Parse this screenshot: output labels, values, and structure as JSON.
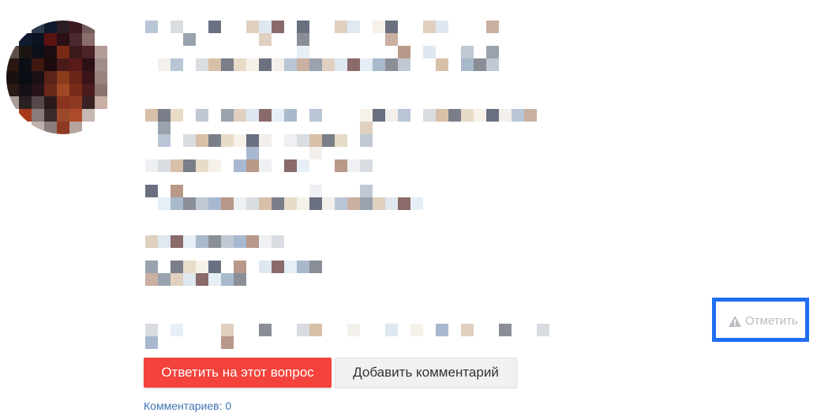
{
  "question": {
    "author": {
      "avatar_alt": ""
    },
    "body_redacted": true
  },
  "report": {
    "label": "Отметить",
    "icon": "warning-triangle-icon",
    "highlight_color": "#1f6ef2",
    "text_color": "#b9bcc1"
  },
  "actions": {
    "answer_label": "Ответить на этот вопрос",
    "comment_label": "Добавить комментарий",
    "answer_color": "#f4433c"
  },
  "comments": {
    "label": "Комментариев:",
    "count": "0",
    "link_color": "#3e73b1"
  }
}
